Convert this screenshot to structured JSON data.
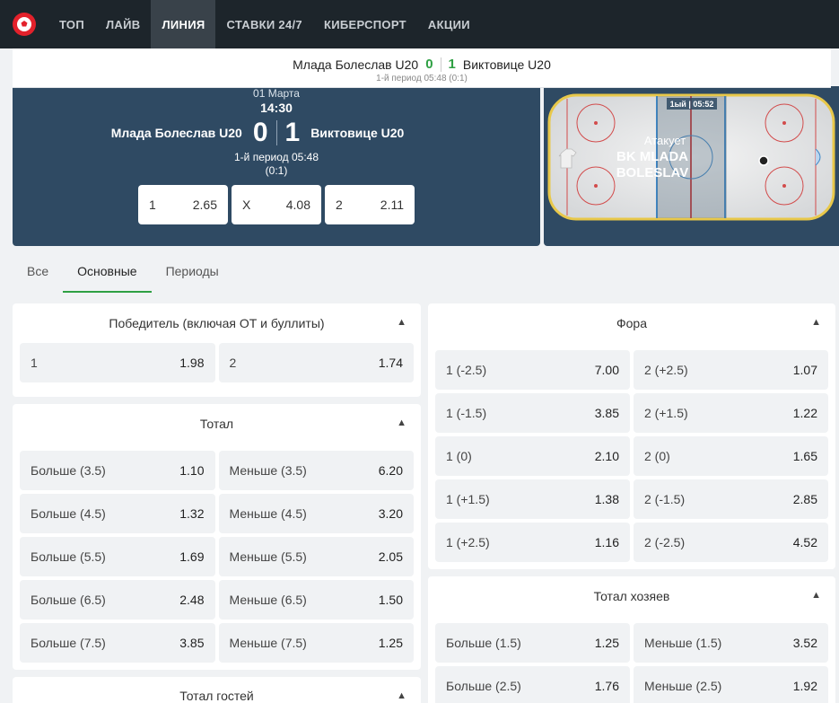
{
  "nav": {
    "items": [
      "ТОП",
      "ЛАЙВ",
      "ЛИНИЯ",
      "СТАВКИ 24/7",
      "КИБЕРСПОРТ",
      "АКЦИИ"
    ],
    "active_index": 2
  },
  "scorebar": {
    "home": "Млада Болеслав U20",
    "home_score": "0",
    "away_score": "1",
    "away": "Виктовице U20",
    "status": "1-й период 05:48 (0:1)"
  },
  "event": {
    "date": "01 Марта",
    "time": "14:30",
    "home": "Млада Болеслав U20",
    "away": "Виктовице U20",
    "home_score": "0",
    "away_score": "1",
    "period": "1-й период 05:48",
    "period_score": "(0:1)",
    "odds": [
      {
        "label": "1",
        "value": "2.65"
      },
      {
        "label": "X",
        "value": "4.08"
      },
      {
        "label": "2",
        "value": "2.11"
      }
    ]
  },
  "rink": {
    "clock": "1ый | 05:52",
    "attack_label": "Атакует",
    "attack_team_line1": "BK MLADA",
    "attack_team_line2": "BOLESLAV"
  },
  "tabs": [
    "Все",
    "Основные",
    "Периоды"
  ],
  "markets": {
    "winner": {
      "title": "Победитель (включая ОТ и буллиты)",
      "rows": [
        [
          {
            "l": "1",
            "v": "1.98"
          },
          {
            "l": "2",
            "v": "1.74"
          }
        ]
      ]
    },
    "total": {
      "title": "Тотал",
      "rows": [
        [
          {
            "l": "Больше (3.5)",
            "v": "1.10"
          },
          {
            "l": "Меньше (3.5)",
            "v": "6.20"
          }
        ],
        [
          {
            "l": "Больше (4.5)",
            "v": "1.32"
          },
          {
            "l": "Меньше (4.5)",
            "v": "3.20"
          }
        ],
        [
          {
            "l": "Больше (5.5)",
            "v": "1.69"
          },
          {
            "l": "Меньше (5.5)",
            "v": "2.05"
          }
        ],
        [
          {
            "l": "Больше (6.5)",
            "v": "2.48"
          },
          {
            "l": "Меньше (6.5)",
            "v": "1.50"
          }
        ],
        [
          {
            "l": "Больше (7.5)",
            "v": "3.85"
          },
          {
            "l": "Меньше (7.5)",
            "v": "1.25"
          }
        ]
      ]
    },
    "away_total": {
      "title": "Тотал гостей"
    },
    "handicap": {
      "title": "Фора",
      "rows": [
        [
          {
            "l": "1 (-2.5)",
            "v": "7.00"
          },
          {
            "l": "2 (+2.5)",
            "v": "1.07"
          }
        ],
        [
          {
            "l": "1 (-1.5)",
            "v": "3.85"
          },
          {
            "l": "2 (+1.5)",
            "v": "1.22"
          }
        ],
        [
          {
            "l": "1 (0)",
            "v": "2.10"
          },
          {
            "l": "2 (0)",
            "v": "1.65"
          }
        ],
        [
          {
            "l": "1 (+1.5)",
            "v": "1.38"
          },
          {
            "l": "2 (-1.5)",
            "v": "2.85"
          }
        ],
        [
          {
            "l": "1 (+2.5)",
            "v": "1.16"
          },
          {
            "l": "2 (-2.5)",
            "v": "4.52"
          }
        ]
      ]
    },
    "home_total": {
      "title": "Тотал хозяев",
      "rows": [
        [
          {
            "l": "Больше (1.5)",
            "v": "1.25"
          },
          {
            "l": "Меньше (1.5)",
            "v": "3.52"
          }
        ],
        [
          {
            "l": "Больше (2.5)",
            "v": "1.76"
          },
          {
            "l": "Меньше (2.5)",
            "v": "1.92"
          }
        ]
      ]
    }
  }
}
